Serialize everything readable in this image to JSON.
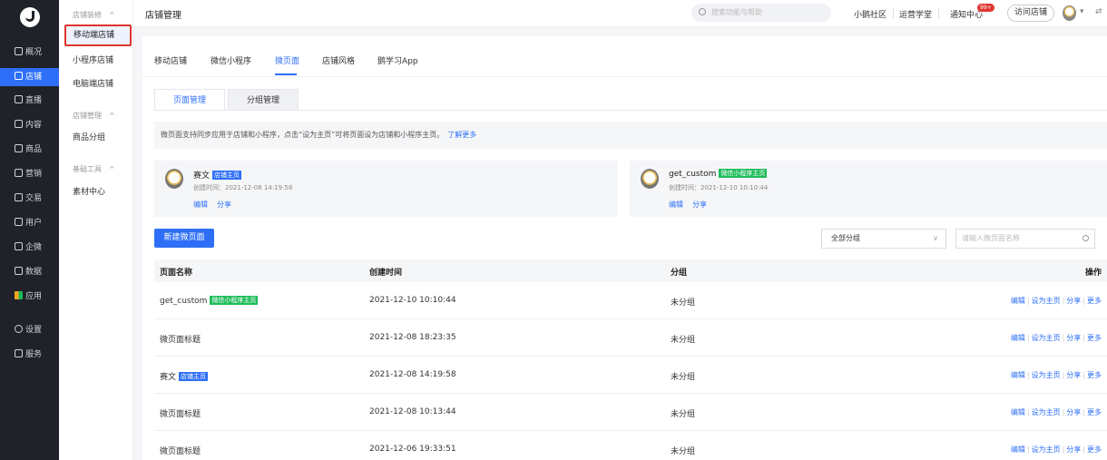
{
  "sidebar": {
    "items": [
      {
        "label": "概况",
        "icon": "chart-icon"
      },
      {
        "label": "店铺",
        "icon": "shop-icon"
      },
      {
        "label": "直播",
        "icon": "live-icon"
      },
      {
        "label": "内容",
        "icon": "content-icon"
      },
      {
        "label": "商品",
        "icon": "goods-icon"
      },
      {
        "label": "营销",
        "icon": "marketing-icon"
      },
      {
        "label": "交易",
        "icon": "trade-icon"
      },
      {
        "label": "用户",
        "icon": "user-icon"
      },
      {
        "label": "企微",
        "icon": "wecom-icon"
      },
      {
        "label": "数据",
        "icon": "data-icon"
      },
      {
        "label": "应用",
        "icon": "apps-icon"
      },
      {
        "label": "设置",
        "icon": "settings-icon"
      },
      {
        "label": "服务",
        "icon": "service-icon"
      }
    ]
  },
  "subnav": {
    "group1": "店铺装修",
    "items1": [
      "移动端店铺",
      "小程序店铺",
      "电脑端店铺"
    ],
    "group2": "店铺管理",
    "items2": [
      "商品分组"
    ],
    "group3": "基础工具",
    "items3": [
      "素材中心"
    ]
  },
  "topbar": {
    "title": "店铺管理",
    "search_placeholder": "搜索功能与帮助",
    "links": [
      "小鹅社区",
      "运营学堂",
      "通知中心"
    ],
    "badge": "99+",
    "visit_button": "访问店铺"
  },
  "tabs": [
    "移动店铺",
    "微信小程序",
    "微页面",
    "店铺风格",
    "鹅学习App"
  ],
  "subtabs": [
    "页面管理",
    "分组管理"
  ],
  "notice": {
    "text": "微页面支持同步应用于店铺和小程序，点击“设为主页”可将页面设为店铺和小程序主页。",
    "link": "了解更多"
  },
  "home_cards": [
    {
      "name": "赛文",
      "tag": "店铺主页",
      "time": "创建时间：2021-12-08 14:19:58",
      "actions": [
        "编辑",
        "分享"
      ]
    },
    {
      "name": "get_custom",
      "tag": "微信小程序主页",
      "time": "创建时间：2021-12-10 10:10:44",
      "actions": [
        "编辑",
        "分享"
      ]
    }
  ],
  "toolbar": {
    "new_button": "新建微页面",
    "group_select": "全部分组",
    "search_placeholder": "请输入微页面名称"
  },
  "table": {
    "headers": [
      "页面名称",
      "创建时间",
      "分组",
      "操作"
    ],
    "rows": [
      {
        "name": "get_custom",
        "tag": "微信小程序主页",
        "time": "2021-12-10 10:10:44",
        "group": "未分组"
      },
      {
        "name": "微页面标题",
        "tag": "",
        "time": "2021-12-08 18:23:35",
        "group": "未分组"
      },
      {
        "name": "赛文",
        "tag": "店铺主页",
        "time": "2021-12-08 14:19:58",
        "group": "未分组"
      },
      {
        "name": "微页面标题",
        "tag": "",
        "time": "2021-12-08 10:13:44",
        "group": "未分组"
      },
      {
        "name": "微页面标题",
        "tag": "",
        "time": "2021-12-06 19:33:51",
        "group": "未分组"
      }
    ],
    "row_actions": [
      "编辑",
      "设为主页",
      "分享",
      "更多"
    ]
  },
  "colors": {
    "accent": "#2d6ff7",
    "sidebar": "#1f2329",
    "highlight_border": "#e0362e",
    "green_tag": "#1fbc5a"
  }
}
